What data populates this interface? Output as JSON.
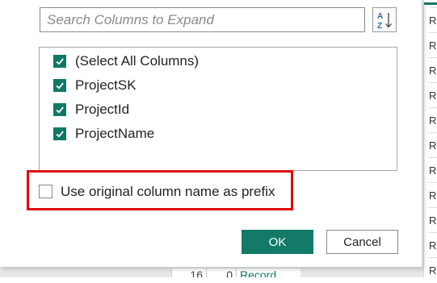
{
  "search": {
    "placeholder": "Search Columns to Expand",
    "value": ""
  },
  "sort_button": {
    "icon": "sort-a-z-icon"
  },
  "columns": [
    {
      "label": "(Select All Columns)",
      "checked": true
    },
    {
      "label": "ProjectSK",
      "checked": true
    },
    {
      "label": "ProjectId",
      "checked": true
    },
    {
      "label": "ProjectName",
      "checked": true
    }
  ],
  "prefix_option": {
    "label": "Use original column name as prefix",
    "checked": false
  },
  "buttons": {
    "ok_label": "OK",
    "cancel_label": "Cancel"
  },
  "background_grid": {
    "cell_prefix": "R",
    "bottom_row": {
      "row_number": "16",
      "index": "0",
      "value": "Record"
    }
  },
  "colors": {
    "accent": "#117865",
    "highlight": "#e00b0b"
  }
}
